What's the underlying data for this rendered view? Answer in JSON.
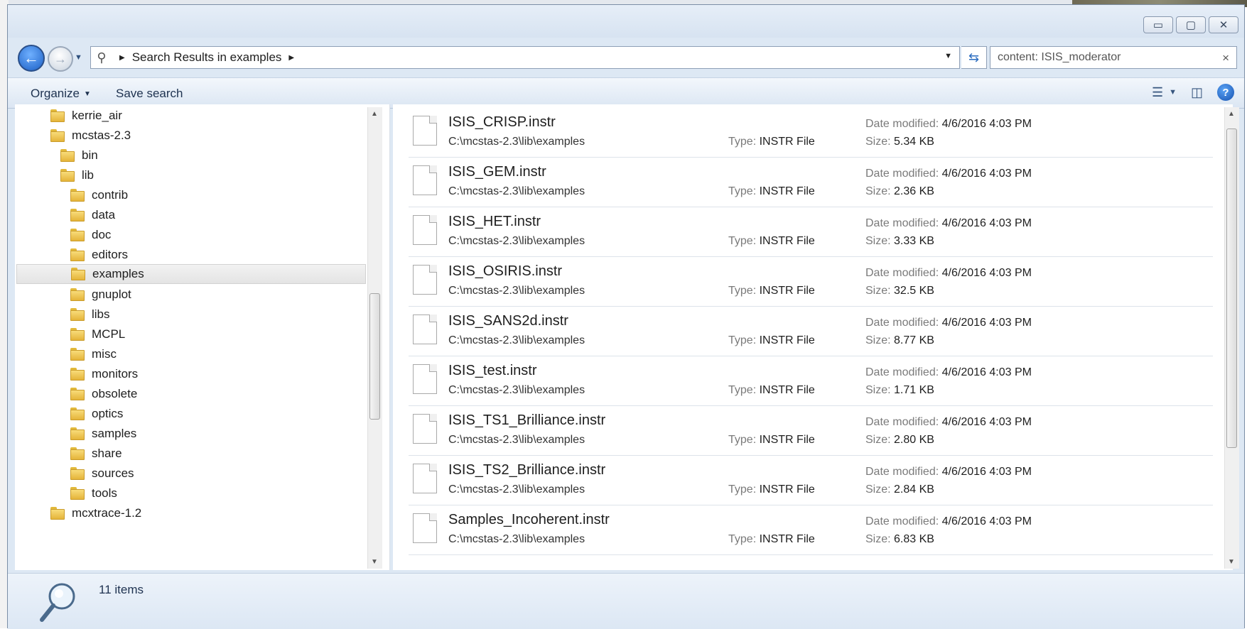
{
  "window": {
    "controls": {
      "minimize": "▭",
      "maximize": "▢",
      "close": "✕"
    }
  },
  "nav": {
    "breadcrumb": "Search Results in examples",
    "search_value": "content: ISIS_moderator",
    "search_clear": "×"
  },
  "toolbar": {
    "organize_label": "Organize",
    "save_search_label": "Save search"
  },
  "tree": {
    "items": [
      {
        "label": "kerrie_air"
      },
      {
        "label": "mcstas-2.3"
      },
      {
        "label": "bin"
      },
      {
        "label": "lib"
      },
      {
        "label": "contrib"
      },
      {
        "label": "data"
      },
      {
        "label": "doc"
      },
      {
        "label": "editors"
      },
      {
        "label": "examples",
        "selected": true
      },
      {
        "label": "gnuplot"
      },
      {
        "label": "libs"
      },
      {
        "label": "MCPL"
      },
      {
        "label": "misc"
      },
      {
        "label": "monitors"
      },
      {
        "label": "obsolete"
      },
      {
        "label": "optics"
      },
      {
        "label": "samples"
      },
      {
        "label": "share"
      },
      {
        "label": "sources"
      },
      {
        "label": "tools"
      },
      {
        "label": "mcxtrace-1.2"
      }
    ]
  },
  "labels": {
    "type": "Type:",
    "date_modified": "Date modified:",
    "size": "Size:"
  },
  "files": [
    {
      "name": "ISIS_CRISP.instr",
      "path": "C:\\mcstas-2.3\\lib\\examples",
      "type": "INSTR File",
      "date": "4/6/2016 4:03 PM",
      "size": "5.34 KB"
    },
    {
      "name": "ISIS_GEM.instr",
      "path": "C:\\mcstas-2.3\\lib\\examples",
      "type": "INSTR File",
      "date": "4/6/2016 4:03 PM",
      "size": "2.36 KB"
    },
    {
      "name": "ISIS_HET.instr",
      "path": "C:\\mcstas-2.3\\lib\\examples",
      "type": "INSTR File",
      "date": "4/6/2016 4:03 PM",
      "size": "3.33 KB"
    },
    {
      "name": "ISIS_OSIRIS.instr",
      "path": "C:\\mcstas-2.3\\lib\\examples",
      "type": "INSTR File",
      "date": "4/6/2016 4:03 PM",
      "size": "32.5 KB"
    },
    {
      "name": "ISIS_SANS2d.instr",
      "path": "C:\\mcstas-2.3\\lib\\examples",
      "type": "INSTR File",
      "date": "4/6/2016 4:03 PM",
      "size": "8.77 KB"
    },
    {
      "name": "ISIS_test.instr",
      "path": "C:\\mcstas-2.3\\lib\\examples",
      "type": "INSTR File",
      "date": "4/6/2016 4:03 PM",
      "size": "1.71 KB"
    },
    {
      "name": "ISIS_TS1_Brilliance.instr",
      "path": "C:\\mcstas-2.3\\lib\\examples",
      "type": "INSTR File",
      "date": "4/6/2016 4:03 PM",
      "size": "2.80 KB"
    },
    {
      "name": "ISIS_TS2_Brilliance.instr",
      "path": "C:\\mcstas-2.3\\lib\\examples",
      "type": "INSTR File",
      "date": "4/6/2016 4:03 PM",
      "size": "2.84 KB"
    },
    {
      "name": "Samples_Incoherent.instr",
      "path": "C:\\mcstas-2.3\\lib\\examples",
      "type": "INSTR File",
      "date": "4/6/2016 4:03 PM",
      "size": "6.83 KB"
    }
  ],
  "details": {
    "count": "11 items"
  }
}
